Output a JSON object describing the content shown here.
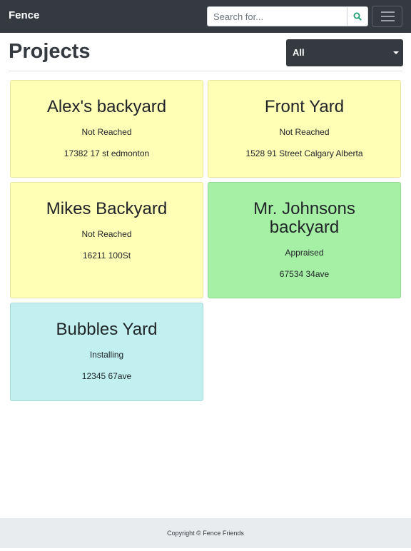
{
  "navbar": {
    "brand": "Fence",
    "search_placeholder": "Search for..."
  },
  "header": {
    "title": "Projects",
    "filter_value": "All"
  },
  "projects": [
    {
      "name": "Alex's backyard",
      "status": "Not Reached",
      "address": "17382 17 st edmonton",
      "color": "#ffffb6"
    },
    {
      "name": "Front Yard",
      "status": "Not Reached",
      "address": "1528 91 Street Calgary Alberta",
      "color": "#ffffb6"
    },
    {
      "name": "Mikes Backyard",
      "status": "Not Reached",
      "address": "16211 100St",
      "color": "#ffffb6"
    },
    {
      "name": "Mr. Johnsons backyard",
      "status": "Appraised",
      "address": "67534 34ave",
      "color": "#a6f0a6"
    },
    {
      "name": "Bubbles Yard",
      "status": "Installing",
      "address": "12345 67ave",
      "color": "#c2f0f0"
    }
  ],
  "footer": {
    "copyright": "Copyright © Fence Friends"
  },
  "colors": {
    "navbar": "#343a40",
    "search_icon": "#20a070",
    "not_reached": "#ffffb6",
    "appraised": "#a6f0a6",
    "installing": "#c2f0f0"
  },
  "icons": [
    "search-icon",
    "hamburger-icon",
    "caret-down-icon"
  ]
}
